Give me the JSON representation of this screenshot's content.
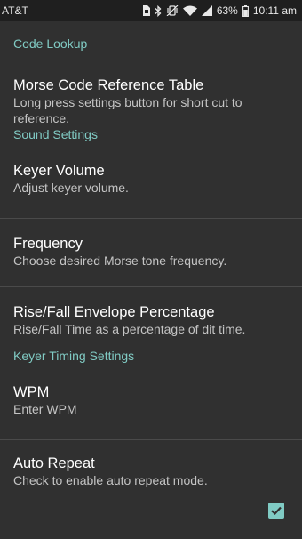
{
  "status_bar": {
    "carrier": "AT&T",
    "battery": "63%",
    "time": "10:11 am"
  },
  "categories": {
    "code_lookup": "Code Lookup",
    "sound_settings": "Sound Settings",
    "keyer_timing": "Keyer Timing Settings"
  },
  "prefs": {
    "reference_table": {
      "title": "Morse Code Reference Table",
      "summary": "Long press settings button for short cut to reference."
    },
    "keyer_volume": {
      "title": "Keyer Volume",
      "summary": "Adjust keyer volume."
    },
    "frequency": {
      "title": "Frequency",
      "summary": "Choose desired Morse tone frequency."
    },
    "rise_fall": {
      "title": "Rise/Fall Envelope Percentage",
      "summary": "Rise/Fall Time as a percentage of dit time."
    },
    "wpm": {
      "title": "WPM",
      "summary": "Enter WPM"
    },
    "auto_repeat": {
      "title": "Auto Repeat",
      "summary": "Check to enable auto repeat mode.",
      "checked": true
    }
  },
  "colors": {
    "accent": "#80cbc4",
    "background": "#303030",
    "status_bar": "#1f1f1f"
  },
  "icons": [
    "sim-icon",
    "bluetooth-icon",
    "vibrate-icon",
    "wifi-icon",
    "signal-icon",
    "battery-icon"
  ]
}
